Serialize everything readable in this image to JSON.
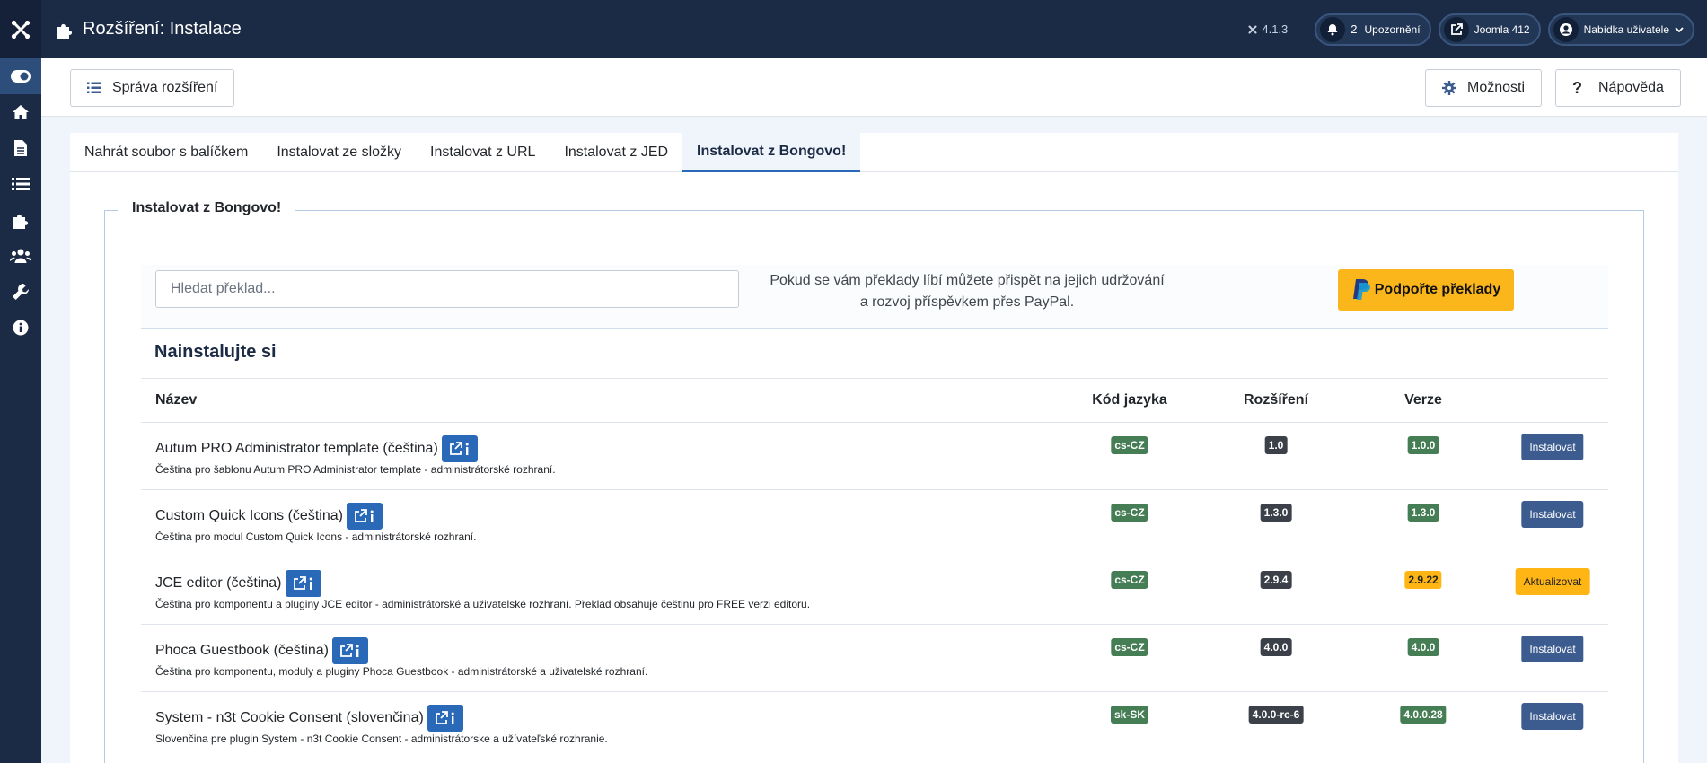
{
  "header": {
    "title": "Rozšíření: Instalace",
    "version": "4.1.3",
    "notifications_count": "2",
    "notifications_label": "Upozornění",
    "site_label": "Joomla 412",
    "user_menu_label": "Nabídka uživatele"
  },
  "sidebar": {
    "items": [
      {
        "icon": "toggle-icon",
        "active": true
      },
      {
        "icon": "home-icon"
      },
      {
        "icon": "file-icon"
      },
      {
        "icon": "list-icon"
      },
      {
        "icon": "puzzle-icon"
      },
      {
        "icon": "users-icon"
      },
      {
        "icon": "wrench-icon"
      },
      {
        "icon": "info-icon"
      }
    ]
  },
  "toolbar": {
    "manage_label": "Správa rozšíření",
    "options_label": "Možnosti",
    "help_label": "Nápověda"
  },
  "tabs": [
    {
      "label": "Nahrát soubor s balíčkem"
    },
    {
      "label": "Instalovat ze složky"
    },
    {
      "label": "Instalovat z URL"
    },
    {
      "label": "Instalovat z JED"
    },
    {
      "label": "Instalovat z Bongovo!",
      "active": true
    }
  ],
  "panel": {
    "legend": "Instalovat z Bongovo!",
    "search_placeholder": "Hledat překlad...",
    "support_text": "Pokud se vám překlady líbí můžete přispět na jejich udržování a rozvoj příspěvkem přes PayPal.",
    "paypal_label": "Podpořte překlady",
    "section_title": "Nainstalujte si"
  },
  "table": {
    "columns": [
      "Název",
      "Kód jazyka",
      "Rozšíření",
      "Verze"
    ],
    "rows": [
      {
        "name": "Autum PRO Administrator template (čeština)",
        "desc": "Čeština pro šablonu Autum PRO Administrator template - administrátorské rozhraní.",
        "lang": "cs-CZ",
        "ext": "1.0",
        "ver": "1.0.0",
        "ver_status": "green",
        "action": "Instalovat",
        "action_type": "install"
      },
      {
        "name": "Custom Quick Icons (čeština)",
        "desc": "Čeština pro modul Custom Quick Icons - administrátorské rozhraní.",
        "lang": "cs-CZ",
        "ext": "1.3.0",
        "ver": "1.3.0",
        "ver_status": "green",
        "action": "Instalovat",
        "action_type": "install"
      },
      {
        "name": "JCE editor (čeština)",
        "desc": "Čeština pro komponentu a pluginy JCE editor - administrátorské a uživatelské rozhraní. Překlad obsahuje češtinu pro FREE verzi editoru.",
        "lang": "cs-CZ",
        "ext": "2.9.4",
        "ver": "2.9.22",
        "ver_status": "yellow",
        "action": "Aktualizovat",
        "action_type": "update"
      },
      {
        "name": "Phoca Guestbook (čeština)",
        "desc": "Čeština pro komponentu, moduly a pluginy Phoca Guestbook - administrátorské a uživatelské rozhraní.",
        "lang": "cs-CZ",
        "ext": "4.0.0",
        "ver": "4.0.0",
        "ver_status": "green",
        "action": "Instalovat",
        "action_type": "install"
      },
      {
        "name": "System - n3t Cookie Consent (slovenčina)",
        "desc": "Slovenčina pre plugin System - n3t Cookie Consent - administrátorske a užívateľské rozhranie.",
        "lang": "sk-SK",
        "ext": "4.0.0-rc-6",
        "ver": "4.0.0.28",
        "ver_status": "green",
        "action": "Instalovat",
        "action_type": "install"
      }
    ]
  },
  "colors": {
    "header_bg": "#1c2b45",
    "accent_blue": "#2a69b8",
    "badge_green": "#457d54",
    "badge_dark": "#3b4049",
    "badge_yellow": "#ffb514",
    "install_button": "#3c5b8f",
    "paypal_button": "#fbb61b"
  }
}
